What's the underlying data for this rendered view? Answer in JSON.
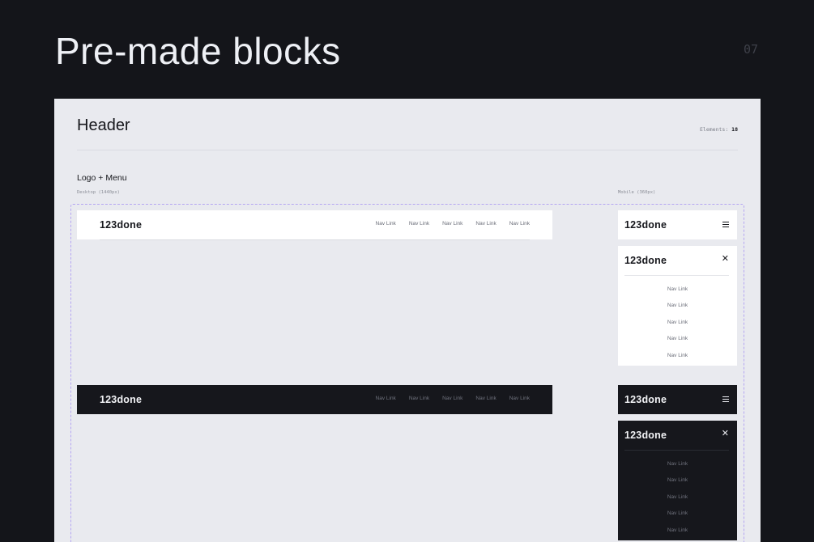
{
  "page": {
    "title": "Pre-made blocks",
    "number": "07"
  },
  "panel": {
    "title": "Header",
    "elements_label": "Elements:",
    "elements_count": "18",
    "block_title": "Logo + Menu",
    "desktop_caption": "Desktop (1440px)",
    "mobile_caption": "Mobile (360px)"
  },
  "logo": "123done",
  "nav_links": [
    "Nav Link",
    "Nav Link",
    "Nav Link",
    "Nav Link",
    "Nav Link"
  ],
  "icons": {
    "menu": "hamburger-icon",
    "close": "close-icon"
  },
  "colors": {
    "light_bg": "#ffffff",
    "dark_bg": "#16171c",
    "accent_dashed": "#b5a6f2"
  }
}
